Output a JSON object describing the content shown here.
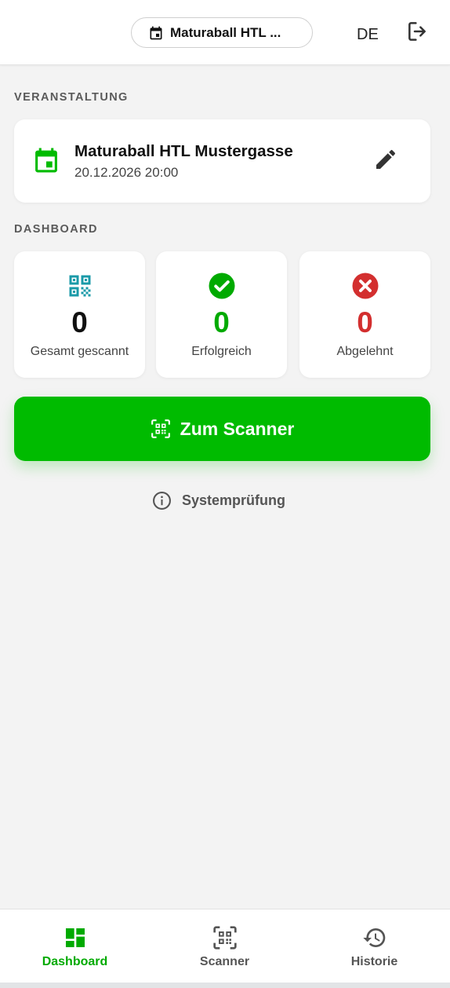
{
  "header": {
    "event_selector": "Maturaball HTL ...",
    "language": "DE"
  },
  "sections": {
    "event": "VERANSTALTUNG",
    "dashboard": "DASHBOARD"
  },
  "event": {
    "name": "Maturaball HTL Mustergasse",
    "datetime": "20.12.2026 20:00"
  },
  "stats": [
    {
      "value": "0",
      "label": "Gesamt gescannt",
      "icon": "qr-code-icon",
      "color": "#1a9aa8"
    },
    {
      "value": "0",
      "label": "Erfolgreich",
      "icon": "check-circle-icon",
      "color": "#00aa00"
    },
    {
      "value": "0",
      "label": "Abgelehnt",
      "icon": "x-circle-icon",
      "color": "#d32f2f"
    }
  ],
  "actions": {
    "scanner_button": "Zum Scanner",
    "system_check": "Systemprüfung"
  },
  "nav": {
    "items": [
      {
        "label": "Dashboard",
        "icon": "dashboard-icon",
        "active": true
      },
      {
        "label": "Scanner",
        "icon": "qr-scan-icon",
        "active": false
      },
      {
        "label": "Historie",
        "icon": "history-icon",
        "active": false
      }
    ]
  },
  "colors": {
    "accent": "#00bb00",
    "background": "#f3f3f3"
  }
}
